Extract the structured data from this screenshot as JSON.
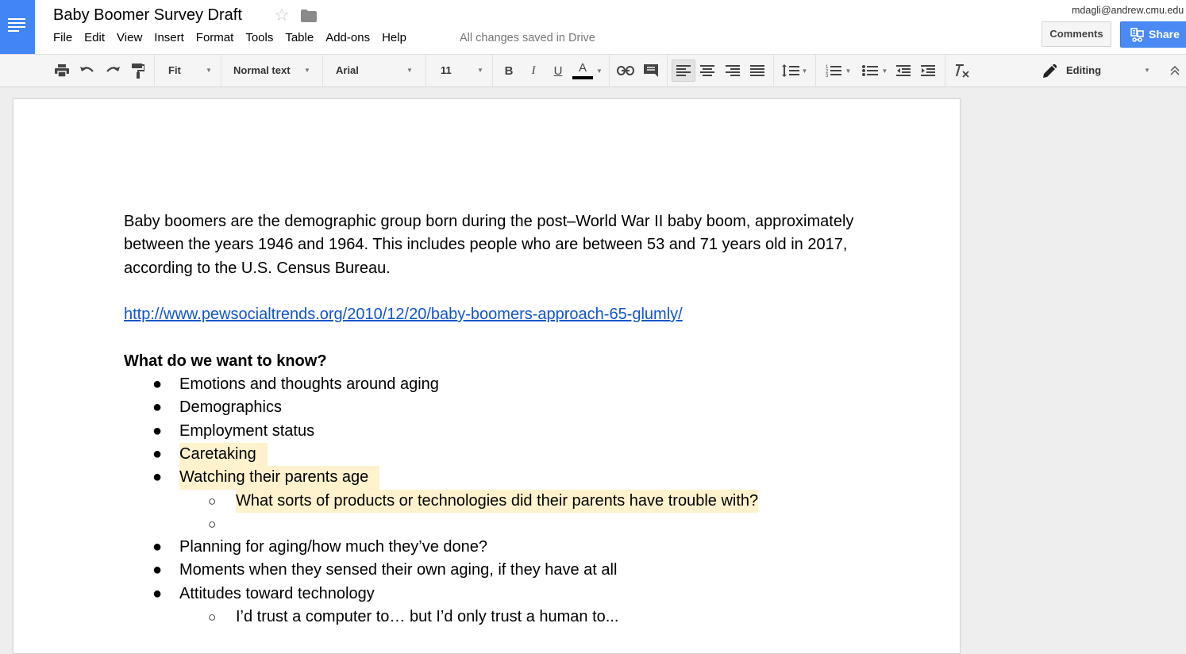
{
  "header": {
    "title": "Baby Boomer Survey Draft",
    "save_status": "All changes saved in Drive",
    "user_email": "mdagli@andrew.cmu.edu",
    "comments_label": "Comments",
    "share_label": "Share",
    "menus": [
      "File",
      "Edit",
      "View",
      "Insert",
      "Format",
      "Tools",
      "Table",
      "Add-ons",
      "Help"
    ]
  },
  "toolbar": {
    "zoom": "Fit",
    "style": "Normal text",
    "font": "Arial",
    "font_size": "11",
    "bold": "B",
    "italic": "I",
    "underline": "U",
    "text_color": "A",
    "mode": "Editing"
  },
  "document": {
    "intro": "Baby boomers are the demographic group born during the post–World War II baby boom, approximately between the years 1946 and 1964. This includes people who are between 53 and 71 years old in 2017, according to the U.S. Census Bureau.",
    "link": "http://www.pewsocialtrends.org/2010/12/20/baby-boomers-approach-65-glumly/",
    "heading": "What do we want to know?",
    "bullet_symbol": "●",
    "sub_bullet_symbol": "○",
    "items": [
      "Emotions and thoughts around aging",
      "Demographics",
      "Employment status",
      "Caretaking",
      "Watching their parents age",
      "What sorts of products or technologies did their parents have trouble with?",
      "",
      "Planning for aging/how much they’ve done?",
      "Moments when they sensed their own aging, if they have at all",
      "Attitudes toward technology",
      "I’d trust a computer to… but I’d only trust a human to..."
    ]
  },
  "colors": {
    "brand_blue": "#4285f4",
    "link_blue": "#1155cc",
    "highlight_yellow": "#fff2cc",
    "share_blue": "#4a8af4"
  }
}
